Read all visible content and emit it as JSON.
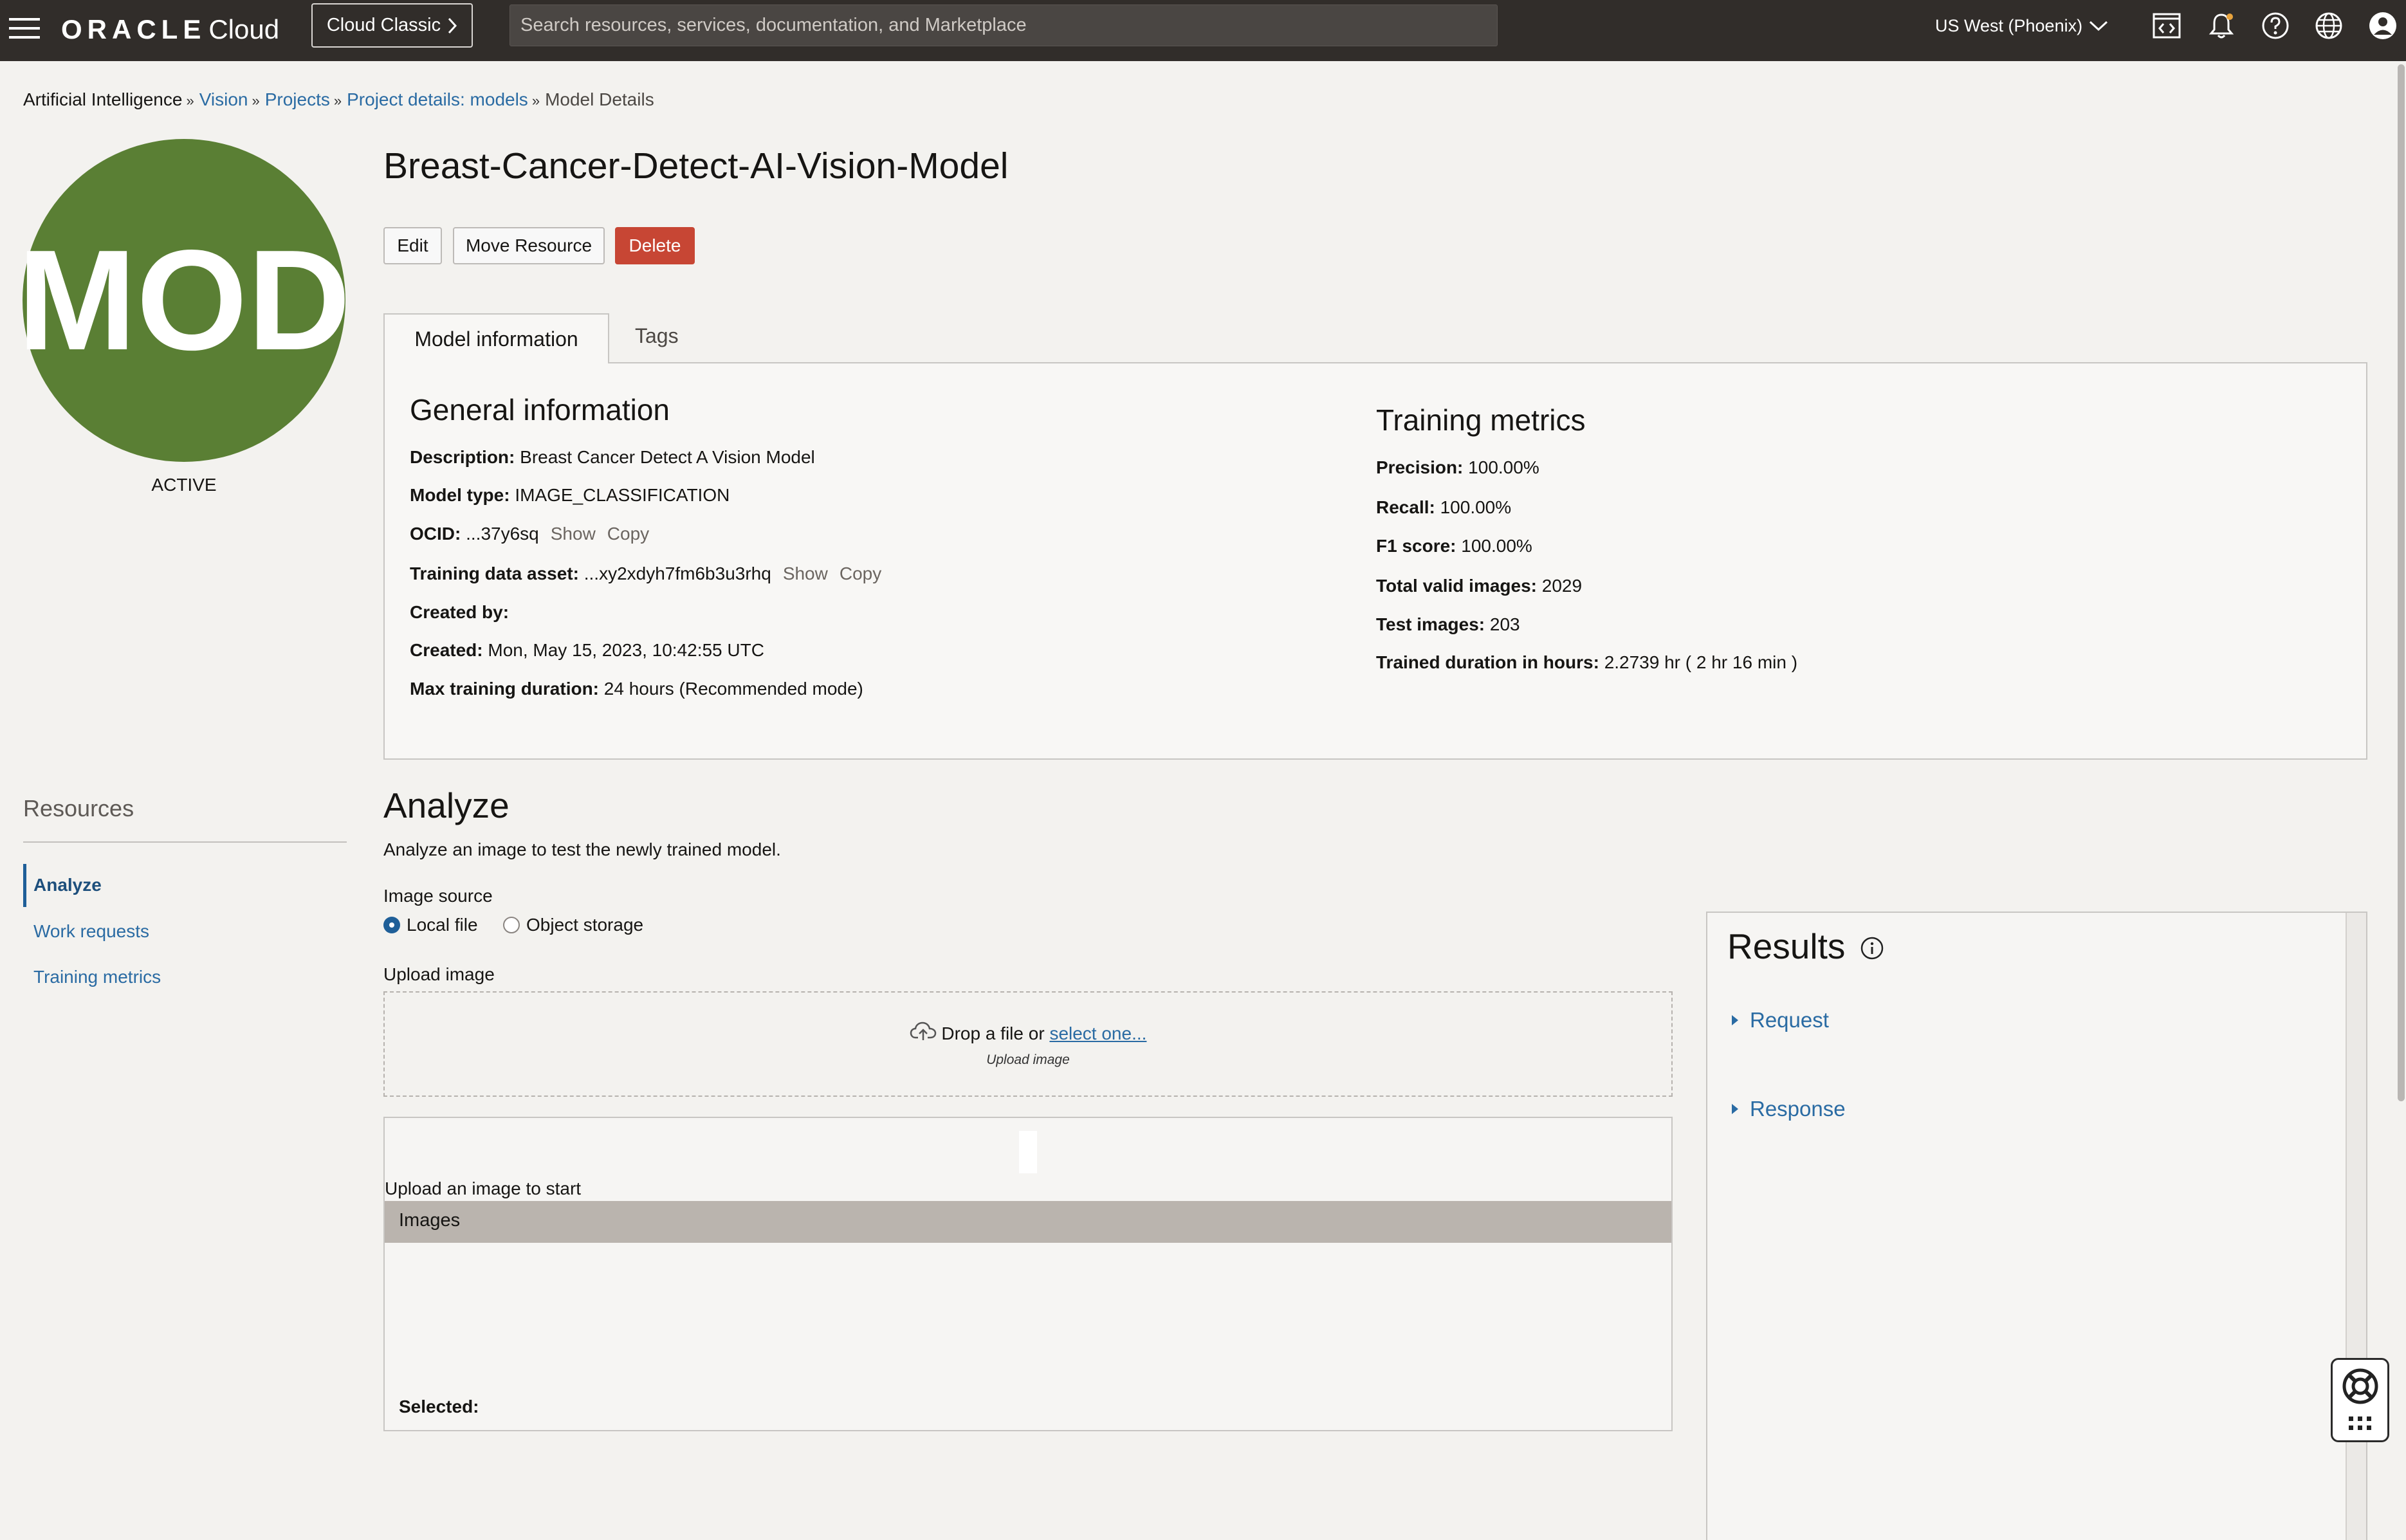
{
  "colors": {
    "header_bg": "#312d2a",
    "page_bg": "#f3f2ef",
    "link": "#2a6ba3",
    "delete_button": "#c74634",
    "avatar": "#5a7f34",
    "images_bar": "#bab4ae"
  },
  "header": {
    "logo_brand": "ORACLE",
    "logo_product": "Cloud",
    "cloud_classic_label": "Cloud Classic",
    "search_placeholder": "Search resources, services, documentation, and Marketplace",
    "region": "US West (Phoenix)",
    "icons": [
      "hamburger-menu-icon",
      "chevron-right-icon",
      "chevron-down-icon",
      "code-editor-icon",
      "bell-icon",
      "help-icon",
      "globe-icon",
      "profile-icon"
    ]
  },
  "breadcrumb": {
    "separator": "»",
    "items": [
      "Artificial Intelligence",
      "Vision",
      "Projects",
      "Project details: models",
      "Model Details"
    ]
  },
  "model": {
    "avatar_text": "MOD",
    "status": "ACTIVE",
    "title": "Breast-Cancer-Detect-AI-Vision-Model"
  },
  "actions": {
    "edit": "Edit",
    "move_resource": "Move Resource",
    "delete": "Delete"
  },
  "tabs": {
    "active": "Model information",
    "items": [
      "Model information",
      "Tags"
    ]
  },
  "general_info": {
    "heading": "General information",
    "fields": [
      {
        "label": "Description:",
        "value": "Breast Cancer Detect A Vision Model"
      },
      {
        "label": "Model type:",
        "value": "IMAGE_CLASSIFICATION"
      },
      {
        "label": "OCID:",
        "value": "...37y6sq",
        "show": "Show",
        "copy": "Copy"
      },
      {
        "label": "Training data asset:",
        "value": "...xy2xdyh7fm6b3u3rhq",
        "show": "Show",
        "copy": "Copy"
      },
      {
        "label": "Created by:"
      },
      {
        "label": "Created:",
        "value": "Mon, May 15, 2023, 10:42:55 UTC"
      },
      {
        "label": "Max training duration:",
        "value": "24 hours (Recommended mode)"
      }
    ]
  },
  "training_metrics": {
    "heading": "Training metrics",
    "fields": [
      {
        "label": "Precision:",
        "value": "100.00%"
      },
      {
        "label": "Recall:",
        "value": "100.00%"
      },
      {
        "label": "F1 score:",
        "value": "100.00%"
      },
      {
        "label": "Total valid images:",
        "value": "2029"
      },
      {
        "label": "Test images:",
        "value": "203"
      },
      {
        "label": "Trained duration in hours:",
        "value": "2.2739 hr ( 2 hr 16 min )"
      }
    ]
  },
  "resources": {
    "heading": "Resources",
    "active": "Analyze",
    "items": [
      "Analyze",
      "Work requests",
      "Training metrics"
    ]
  },
  "analyze": {
    "heading": "Analyze",
    "description": "Analyze an image to test the newly trained model.",
    "image_source_label": "Image source",
    "image_source_options": [
      "Local file",
      "Object storage"
    ],
    "image_source_selected": "Local file",
    "upload_label": "Upload image",
    "drop_text": "Drop a file or",
    "drop_link": "select one...",
    "drop_caption": "Upload image",
    "start_text": "Upload an image to start",
    "images_header": "Images",
    "selected_label": "Selected:"
  },
  "results": {
    "heading": "Results",
    "sections": [
      "Request",
      "Response"
    ]
  }
}
